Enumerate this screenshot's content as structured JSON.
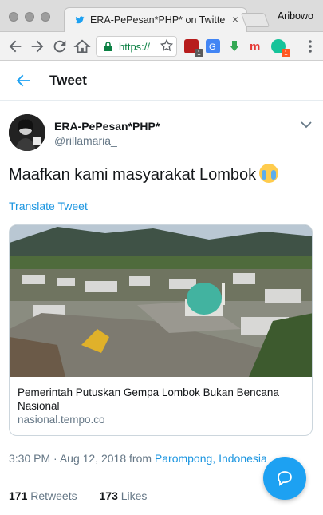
{
  "browser": {
    "tab_title": "ERA-PePesan*PHP* on Twitter",
    "profile_name": "Aribowo",
    "url_text": "https://"
  },
  "header": {
    "title": "Tweet"
  },
  "tweet": {
    "display_name": "ERA-PePesan*PHP*",
    "handle": "@rillamaria_",
    "text": "Maafkan kami masyarakat Lombok",
    "emoji": "loudly-crying-face",
    "translate_label": "Translate Tweet",
    "card": {
      "title": "Pemerintah Putuskan Gempa Lombok Bukan Bencana Nasional",
      "domain": "nasional.tempo.co"
    },
    "time": "3:30 PM",
    "date": "Aug 12, 2018",
    "from_label": "from",
    "location": "Parompong, Indonesia",
    "retweets_count": "171",
    "retweets_label": "Retweets",
    "likes_count": "173",
    "likes_label": "Likes"
  },
  "extensions": [
    {
      "name": "ublock-icon",
      "badge": "1",
      "color": "#b71c1c"
    },
    {
      "name": "translate-icon",
      "badge": "",
      "color": "#4285f4"
    },
    {
      "name": "download-icon",
      "badge": "",
      "color": "#34a853"
    },
    {
      "name": "m-extension-icon",
      "badge": "",
      "color": "#e53935"
    },
    {
      "name": "grammarly-icon",
      "badge": "1",
      "color": "#15c39a"
    }
  ],
  "colors": {
    "accent": "#1da1f2",
    "link": "#1b95e0",
    "secure_url": "#0b8043"
  }
}
